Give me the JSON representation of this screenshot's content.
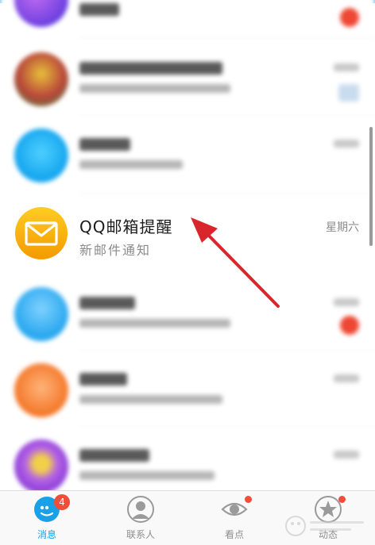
{
  "colors": {
    "accent": "#1aa0e8",
    "badge_red": "#ee4733",
    "mail_yellow": "#f7b500",
    "arrow_red": "#d9262c"
  },
  "focused_conversation": {
    "title": "QQ邮箱提醒",
    "subtitle": "新邮件通知",
    "time": "星期六",
    "icon": "envelope-icon"
  },
  "annotation": {
    "icon": "red-arrow-icon"
  },
  "tabbar": {
    "tabs": [
      {
        "label": "消息",
        "icon": "chat-bubble-icon",
        "badge": "4",
        "active": true
      },
      {
        "label": "联系人",
        "icon": "contact-icon",
        "active": false
      },
      {
        "label": "看点",
        "icon": "eye-icon",
        "active": false,
        "dot": true
      },
      {
        "label": "动态",
        "icon": "star-icon",
        "active": false,
        "dot": true
      }
    ]
  }
}
